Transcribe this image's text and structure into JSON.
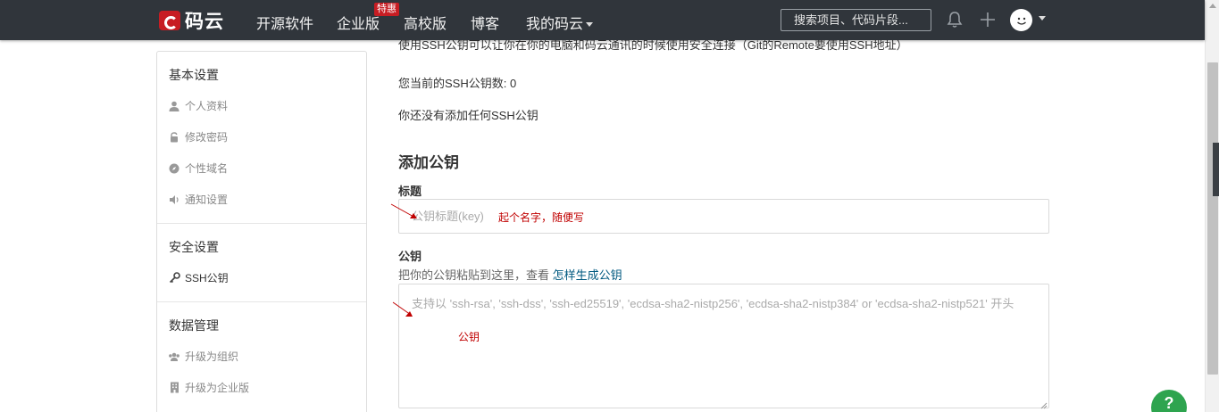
{
  "nav": {
    "logo_text": "码云",
    "items": [
      "开源软件",
      "企业版",
      "高校版",
      "博客",
      "我的码云"
    ],
    "badge": "特惠",
    "search_placeholder": "搜索项目、代码片段..."
  },
  "sidebar": {
    "basic_title": "基本设置",
    "basic_items": [
      {
        "label": "个人资料",
        "icon": "user-icon"
      },
      {
        "label": "修改密码",
        "icon": "lock-icon"
      },
      {
        "label": "个性域名",
        "icon": "compass-icon"
      },
      {
        "label": "通知设置",
        "icon": "volume-icon"
      }
    ],
    "security_title": "安全设置",
    "security_items": [
      {
        "label": "SSH公钥",
        "icon": "key-icon"
      }
    ],
    "data_title": "数据管理",
    "data_items": [
      {
        "label": "升级为组织",
        "icon": "users-icon"
      },
      {
        "label": "升级为企业版",
        "icon": "building-icon"
      }
    ]
  },
  "main": {
    "intro": "使用SSH公钥可以让你在你的电脑和码云通讯的时候使用安全连接（Git的Remote要使用SSH地址）",
    "count_text": "您当前的SSH公钥数: 0",
    "empty_text": "你还没有添加任何SSH公钥",
    "add_heading": "添加公钥",
    "title_label": "标题",
    "title_placeholder": "公钥标题(key)",
    "key_label": "公钥",
    "key_hint": "把你的公钥粘贴到这里，查看",
    "key_hint_link": "怎样生成公钥",
    "key_placeholder": "支持以 'ssh-rsa', 'ssh-dss', 'ssh-ed25519', 'ecdsa-sha2-nistp256', 'ecdsa-sha2-nistp384' or 'ecdsa-sha2-nistp521' 开头"
  },
  "annotations": {
    "title_note": "起个名字，随便写",
    "key_note": "公钥"
  },
  "help_button": "?",
  "colors": {
    "nav_bg": "#30353b",
    "brand_red": "#c71d23",
    "link": "#005980",
    "annotation": "#c00000",
    "help_green": "#2ea44f"
  }
}
